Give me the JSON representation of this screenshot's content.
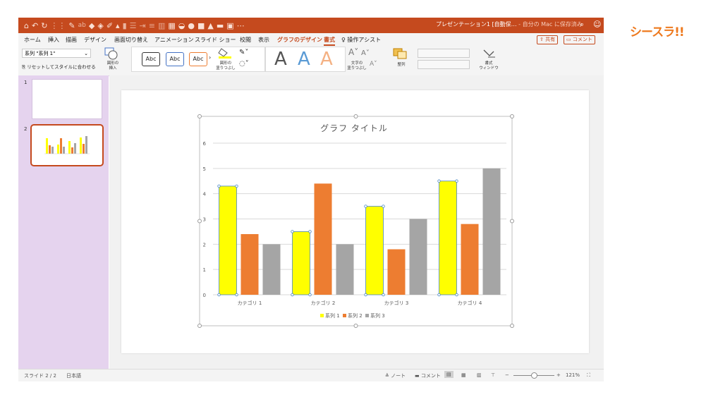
{
  "titlebar": {
    "doc_title": "プレゼンテーション1 [自動保…",
    "save_state": " - 自分の Mac に保存済み",
    "bg_color": "#c54a1e"
  },
  "menu": {
    "items": [
      "ホーム",
      "挿入",
      "描画",
      "デザイン",
      "画面切り替え",
      "アニメーション",
      "スライド ショー",
      "校閲",
      "表示",
      "グラフのデザイン",
      "書式"
    ],
    "assist": "操作アシスト",
    "share": "共有",
    "comment": "コメント"
  },
  "ribbon": {
    "series_select": "系列 \"系列 1\"",
    "reset_label": "リセットしてスタイルに合わせる",
    "insert_shape": "図形の\n挿入",
    "style_abc": [
      "Abc",
      "Abc",
      "Abc"
    ],
    "shape_fill": "図形の\n塗りつぶし",
    "text_fill": "文字の\n塗りつぶし",
    "arrange": "整列",
    "format_pane": "書式\nウィンドウ",
    "wordart_letters": [
      "A",
      "A",
      "A"
    ]
  },
  "thumbnails": {
    "numbers": [
      "1",
      "2"
    ],
    "selected": 2
  },
  "status": {
    "slide_pos": "スライド 2 / 2",
    "language": "日本語",
    "notes": "ノート",
    "comments": "コメント",
    "zoom": "121%"
  },
  "brand": {
    "logo_text": "シースラ!!"
  },
  "chart_data": {
    "type": "bar",
    "title": "グラフ タイトル",
    "categories": [
      "カテゴリ 1",
      "カテゴリ 2",
      "カテゴリ 3",
      "カテゴリ 4"
    ],
    "series": [
      {
        "name": "系列 1",
        "values": [
          4.3,
          2.5,
          3.5,
          4.5
        ],
        "color": "#ffff00"
      },
      {
        "name": "系列 2",
        "values": [
          2.4,
          4.4,
          1.8,
          2.8
        ],
        "color": "#ed7d31"
      },
      {
        "name": "系列 3",
        "values": [
          2,
          2,
          3,
          5
        ],
        "color": "#a5a5a5"
      }
    ],
    "ylim": [
      0,
      6
    ],
    "yticks": [
      "0",
      "1",
      "2",
      "3",
      "4",
      "5",
      "6"
    ],
    "grid": true,
    "legend": "bottom",
    "selected_series": "系列 1"
  }
}
